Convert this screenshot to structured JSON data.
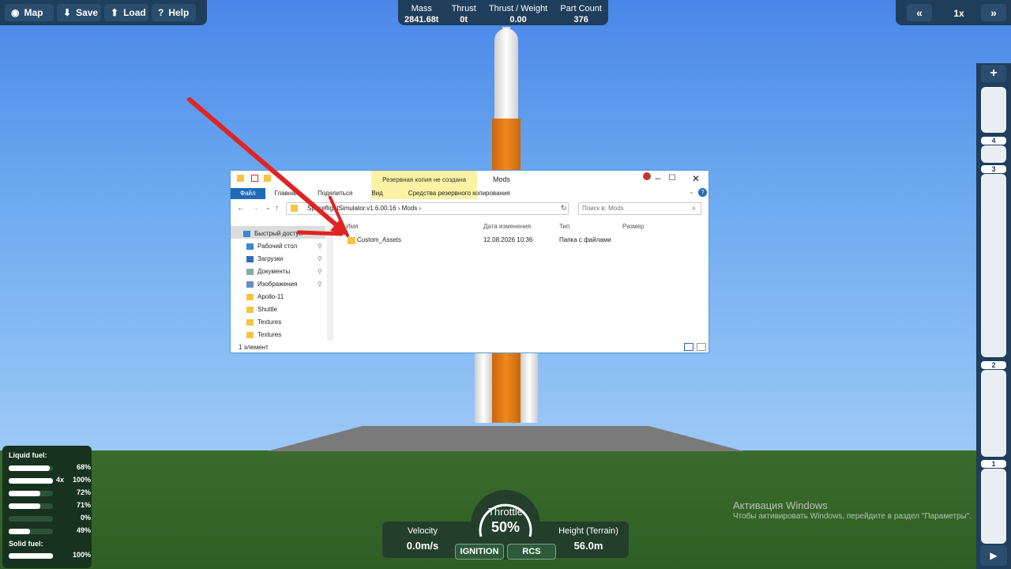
{
  "toolbar": {
    "map": "Map",
    "save": "Save",
    "load": "Load",
    "help": "Help"
  },
  "stats": {
    "mass_label": "Mass",
    "mass_value": "2841.68t",
    "thrust_label": "Thrust",
    "thrust_value": "0t",
    "tw_label": "Thrust / Weight",
    "tw_value": "0.00",
    "parts_label": "Part Count",
    "parts_value": "376"
  },
  "time": {
    "rewind": "«",
    "speed": "1x",
    "forward": "»"
  },
  "stages": {
    "add": "+",
    "numbers": [
      "4",
      "3",
      "2",
      "1"
    ],
    "play": "▶"
  },
  "fuel": {
    "liquid_label": "Liquid fuel:",
    "solid_label": "Solid fuel:",
    "liquid": [
      {
        "pct": "68%",
        "fill": 0.92,
        "mult": ""
      },
      {
        "pct": "100%",
        "fill": 1.0,
        "mult": "4x"
      },
      {
        "pct": "72%",
        "fill": 0.72
      },
      {
        "pct": "71%",
        "fill": 0.71
      },
      {
        "pct": "0%",
        "fill": 0.0
      },
      {
        "pct": "49%",
        "fill": 0.49
      }
    ],
    "solid": [
      {
        "pct": "100%",
        "fill": 1.0
      }
    ]
  },
  "hud": {
    "velocity_label": "Velocity",
    "velocity_value": "0.0m/s",
    "height_label": "Height (Terrain)",
    "height_value": "56.0m",
    "throttle_label": "Throttle",
    "throttle_value": "50%",
    "ignition": "IGNITION",
    "rcs": "RCS"
  },
  "watermark": {
    "title": "Активация Windows",
    "subtitle": "Чтобы активировать Windows, перейдите в раздел \"Параметры\"."
  },
  "explorer": {
    "backup_banner": "Резервная копия не создана",
    "title": "Mods",
    "tabs": [
      "Файл",
      "Главная",
      "Поделиться",
      "Вид"
    ],
    "backup_tab": "Средства резервного копирования",
    "path_a": "SpaceflightSimulator.v1.6.00.16",
    "path_b": "Mods",
    "search_placeholder": "Поиск в: Mods",
    "nav": [
      "Быстрый доступ",
      "Рабочий стол",
      "Загрузки",
      "Документы",
      "Изображения",
      "Apollo-11",
      "Shuttle",
      "Textures",
      "Textures"
    ],
    "columns": [
      "Имя",
      "Дата изменения",
      "Тип",
      "Размер"
    ],
    "row": {
      "name": "Custom_Assets",
      "date": "12.08.2026 10:36",
      "type": "Папка с файлами",
      "size": ""
    },
    "status": "1 элемент"
  }
}
